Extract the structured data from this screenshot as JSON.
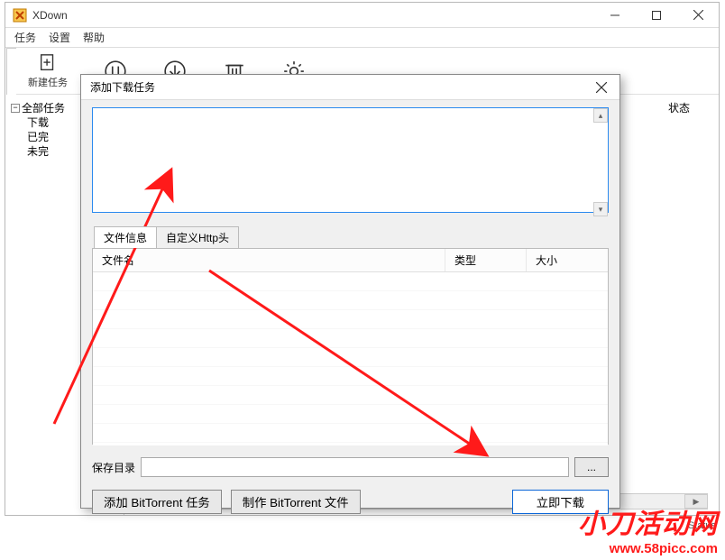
{
  "window": {
    "title": "XDown",
    "menu": {
      "tasks": "任务",
      "settings": "设置",
      "help": "帮助"
    }
  },
  "toolbar": {
    "new_task": "新建任务"
  },
  "sidebar": {
    "root": "全部任务",
    "children": [
      "下载",
      "已完",
      "未完"
    ]
  },
  "main": {
    "state_header": "状态"
  },
  "dialog": {
    "title": "添加下载任务",
    "url_value": "",
    "tabs": {
      "file_info": "文件信息",
      "custom_http": "自定义Http头"
    },
    "table": {
      "col_name": "文件名",
      "col_type": "类型",
      "col_size": "大小"
    },
    "save_label": "保存目录",
    "save_path": "",
    "browse": "...",
    "btn_add_bt": "添加 BitTorrent 任务",
    "btn_make_bt": "制作 BitTorrent 文件",
    "btn_download": "立即下载"
  },
  "watermark": {
    "cn": "小刀活动网",
    "url": "www.58picc.com"
  },
  "status": "Status"
}
